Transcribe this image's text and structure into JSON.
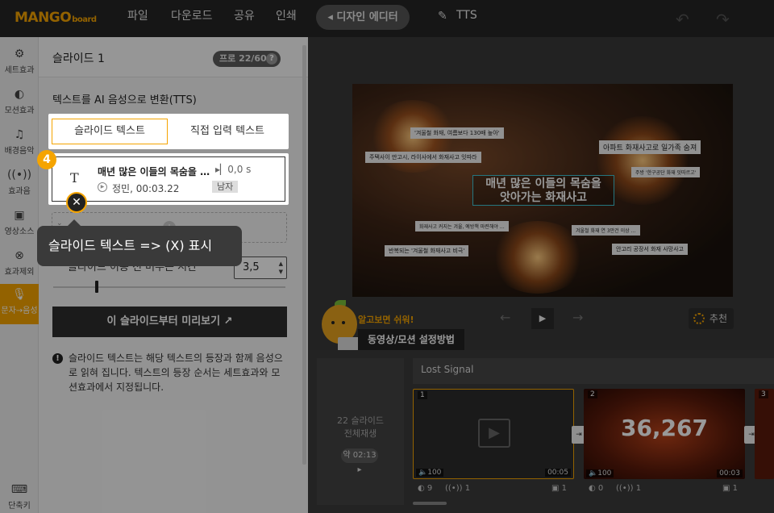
{
  "topbar": {
    "logo": "MANGO",
    "logo_sub": "board",
    "menu": [
      "파일",
      "다운로드",
      "공유",
      "인쇄"
    ],
    "design_editor_label": "◂ 디자인 에디터",
    "project_title": "TTS"
  },
  "rail": [
    {
      "label": "세트효과",
      "icon": "gear-icon"
    },
    {
      "label": "모션효과",
      "icon": "toggle-icon"
    },
    {
      "label": "배경음악",
      "icon": "music-icon"
    },
    {
      "label": "효과음",
      "icon": "sound-wave-icon"
    },
    {
      "label": "영상소스",
      "icon": "video-icon"
    },
    {
      "label": "효과제외",
      "icon": "cancel-circle-icon"
    },
    {
      "label": "문자→음성",
      "icon": "microphone-icon",
      "active": true
    },
    {
      "label": "단축키",
      "icon": "keyboard-icon"
    }
  ],
  "panel": {
    "slide_title": "슬라이드 1",
    "pro_badge": "프로 22/60",
    "section_title": "텍스트를 AI 음성으로 변환(TTS)",
    "tabs": [
      "슬라이드 텍스트",
      "직접 입력 텍스트"
    ],
    "tts_item": {
      "text": "매년 많은 이들의 목숨을 …",
      "voice": "정민, 00:03.22",
      "delay": "0,0 s",
      "gender": "남자"
    },
    "stay_label": "슬라이드 이동 전 머무는 시간",
    "stay_value": "3,5",
    "stay_slider_fraction": 0.18,
    "preview_button": "이 슬라이드부터 미리보기",
    "info_text": "슬라이드 텍스트는 해당 텍스트의 등장과 함께 음성으로 읽혀 집니다. 텍스트의 등장 순서는 세트효과와 모션효과에서 지정됩니다."
  },
  "guide": {
    "step": "4",
    "close": "✕",
    "tooltip": "슬라이드 텍스트   => (X) 표시"
  },
  "canvas": {
    "main_caption_line1": "매년 많은 이들의 목숨을",
    "main_caption_line2": "앗아가는 화재사고",
    "labels": [
      "'겨울철 화재, 여름보다 130배 높아'",
      "주택사이 만고시, 라이사에서 화재사고 잇따라",
      "아파트 화재사고로 일가족 숨져",
      "주방 '한구공단 화재 잇따르고'",
      "화재사고 커지는 겨울, 예방책 마련해야 …",
      "겨울철 화재 연 3만건 이상 …",
      "반복되는 '겨울철 화재사고 비극'",
      "안고리 공장서 화재 사망사고"
    ],
    "mascot_say": "알고보면 쉬워!",
    "howto_label": "동영상/모션 설정방법",
    "recommend_label": "추천"
  },
  "timeline": {
    "play_all_count": "22 슬라이드",
    "play_all_label": "전체재생",
    "play_all_time": "약 02:13 ▸",
    "track_name": "Lost Signal",
    "slides": [
      {
        "num": "1",
        "volume": "100",
        "duration": "00:05",
        "motion": "9",
        "sound": "1",
        "layers": "1"
      },
      {
        "num": "2",
        "volume": "100",
        "duration": "00:03",
        "motion": "0",
        "sound": "1",
        "layers": "1",
        "big_text": "36,267"
      },
      {
        "num": "3"
      }
    ]
  }
}
